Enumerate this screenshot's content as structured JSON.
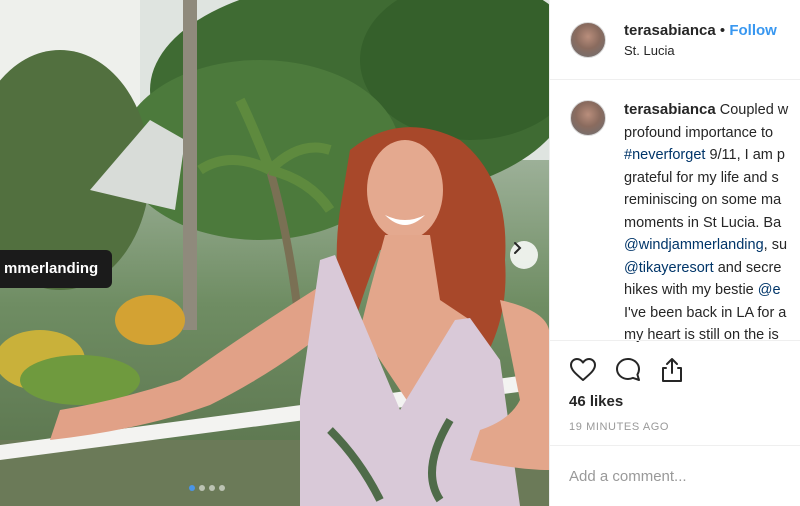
{
  "photo": {
    "tag_label": "mmerlanding",
    "carousel_count": 4,
    "carousel_active_index": 0
  },
  "post": {
    "username": "terasabianca",
    "separator": "•",
    "follow_label": "Follow",
    "location": "St. Lucia"
  },
  "caption": {
    "username": "terasabianca",
    "lines": [
      {
        "text": "Coupled w"
      },
      {
        "text": "profound importance to"
      },
      {
        "link": "#neverforget",
        "text": " 9/11, I am p"
      },
      {
        "text": "grateful for my life and s"
      },
      {
        "text": "reminiscing on some ma"
      },
      {
        "text": "moments in St Lucia. Ba"
      },
      {
        "link": "@windjammerlanding",
        "text": ", su"
      },
      {
        "link": "@tikayeresort",
        "text": " and secre"
      },
      {
        "text": "hikes with my bestie ",
        "link2": "@e"
      },
      {
        "text": "I've been back in LA for a"
      },
      {
        "text": "my heart is still on the is"
      }
    ]
  },
  "actions": {
    "like_icon": "heart-icon",
    "comment_icon": "comment-icon",
    "share_icon": "share-icon"
  },
  "likes_text": "46 likes",
  "timestamp": "19 MINUTES AGO",
  "comment_box": {
    "placeholder": "Add a comment..."
  },
  "colors": {
    "follow": "#3897f0",
    "link": "#003569",
    "muted": "#999999",
    "divider": "#efefef",
    "carousel_active": "#4a95e6"
  }
}
